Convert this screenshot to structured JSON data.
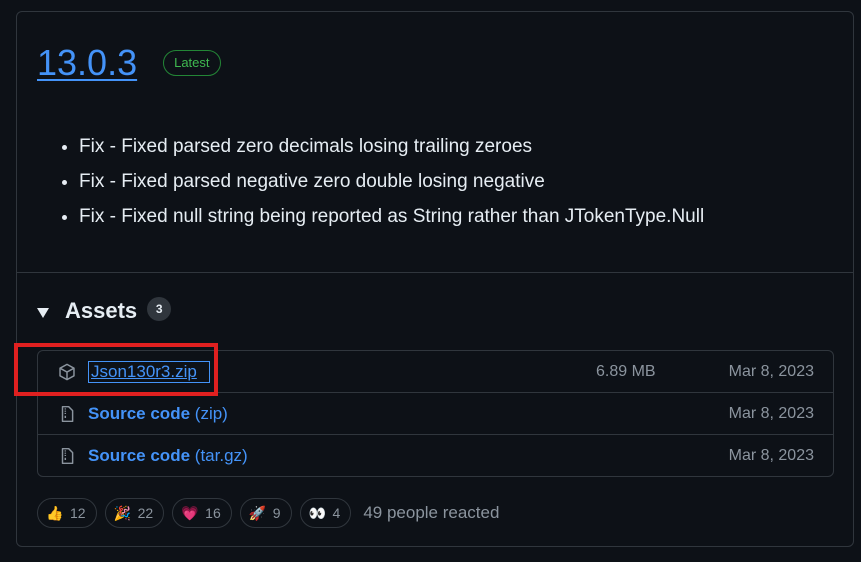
{
  "release": {
    "version": "13.0.3",
    "badge": "Latest",
    "notes": [
      "Fix - Fixed parsed zero decimals losing trailing zeroes",
      "Fix - Fixed parsed negative zero double losing negative",
      "Fix - Fixed null string being reported as String rather than JTokenType.Null"
    ]
  },
  "assets": {
    "title": "Assets",
    "count": "3",
    "items": [
      {
        "name": "Json130r3.zip",
        "suffix": "",
        "size": "6.89 MB",
        "date": "Mar 8, 2023",
        "icon": "package-icon"
      },
      {
        "name": "Source code",
        "suffix": "(zip)",
        "size": "",
        "date": "Mar 8, 2023",
        "icon": "file-zip-icon"
      },
      {
        "name": "Source code",
        "suffix": "(tar.gz)",
        "size": "",
        "date": "Mar 8, 2023",
        "icon": "file-zip-icon"
      }
    ]
  },
  "reactions": {
    "items": [
      {
        "emoji": "👍",
        "count": "12",
        "icon": "thumbs-up-icon"
      },
      {
        "emoji": "🎉",
        "count": "22",
        "icon": "hooray-icon"
      },
      {
        "emoji": "💗",
        "count": "16",
        "icon": "heart-icon"
      },
      {
        "emoji": "🚀",
        "count": "9",
        "icon": "rocket-icon"
      },
      {
        "emoji": "👀",
        "count": "4",
        "icon": "eyes-icon"
      }
    ],
    "summary": "49 people reacted"
  },
  "colors": {
    "accent": "#4493f8",
    "latest_green": "#3fb950",
    "highlight_red": "#e02020",
    "background": "#0d1117"
  }
}
